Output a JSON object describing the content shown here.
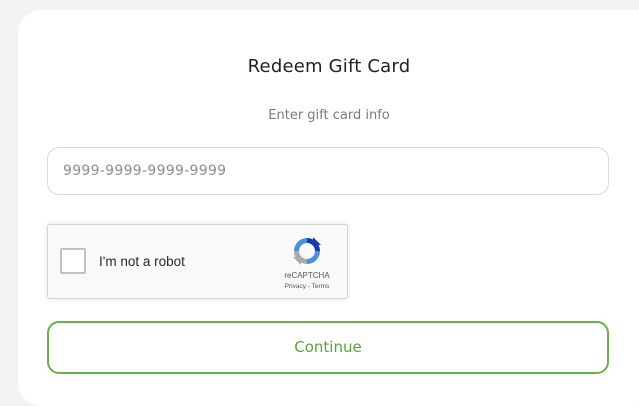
{
  "dialog": {
    "title": "Redeem Gift Card",
    "subtitle": "Enter gift card info"
  },
  "gift_card_input": {
    "value": "",
    "placeholder": "9999-9999-9999-9999"
  },
  "recaptcha": {
    "label": "I'm not a robot",
    "checked": false,
    "brand": "reCAPTCHA",
    "privacy_label": "Privacy",
    "separator": " - ",
    "terms_label": "Terms",
    "icon": "recaptcha-logo-icon"
  },
  "continue_button": {
    "label": "Continue"
  },
  "colors": {
    "accent": "#6ab04c",
    "background": "#f2f3f2",
    "card": "#ffffff"
  }
}
